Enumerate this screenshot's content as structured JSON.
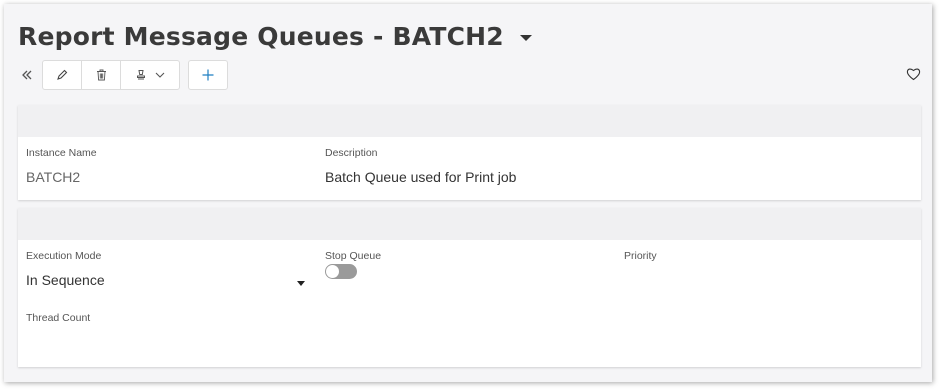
{
  "header": {
    "title": "Report Message Queues - BATCH2"
  },
  "toolbar": {
    "collapse_icon": "double-chevron-left-icon",
    "edit_icon": "pencil-icon",
    "delete_icon": "trash-icon",
    "actions_icon": "stamp-icon",
    "add_icon": "plus-icon",
    "favorite_icon": "heart-icon",
    "accent_color": "#1f7fc2"
  },
  "general": {
    "instance_name_label": "Instance Name",
    "instance_name_value": "BATCH2",
    "description_label": "Description",
    "description_value": "Batch Queue used for Print job"
  },
  "settings": {
    "execution_mode_label": "Execution Mode",
    "execution_mode_value": "In Sequence",
    "stop_queue_label": "Stop Queue",
    "stop_queue_on": false,
    "priority_label": "Priority",
    "thread_count_label": "Thread Count"
  }
}
